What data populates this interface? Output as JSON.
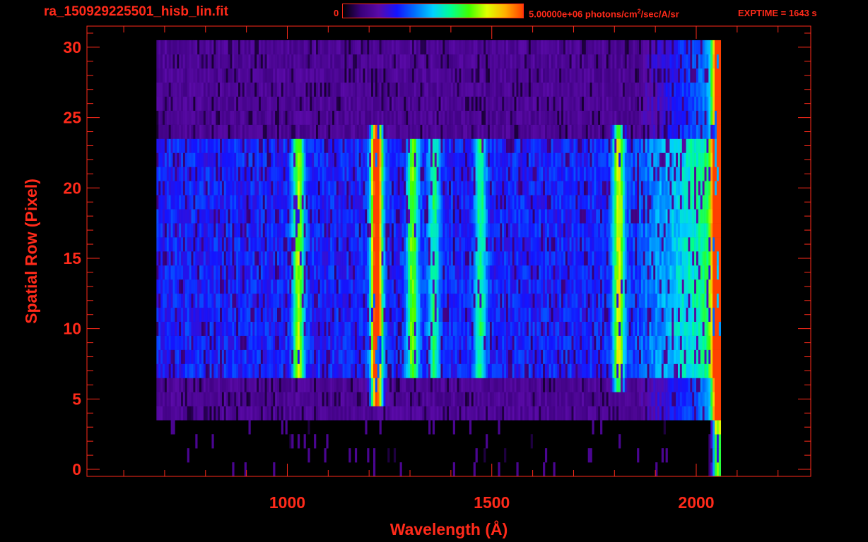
{
  "header": {
    "file_title": "ra_150929225501_hisb_lin.fit",
    "colorbar_min": "0",
    "colorbar_max_prefix": "5.00000e+06 photons/cm",
    "colorbar_max_sup": "2",
    "colorbar_max_suffix": "/sec/A/sr",
    "exptime": "EXPTIME = 1643 s"
  },
  "colors": {
    "text_and_axes": "#ff2a1a",
    "background": "#000000",
    "colormap": [
      "#000000",
      "#3a007a",
      "#5a0aa8",
      "#1414ff",
      "#0070ff",
      "#00d0ff",
      "#00ff90",
      "#40ff00",
      "#e0ff00",
      "#ffb000",
      "#ff4000"
    ]
  },
  "chart_data": {
    "type": "heatmap",
    "xlabel": "Wavelength (Å)",
    "ylabel": "Spatial Row (Pixel)",
    "xlim": [
      510,
      2280
    ],
    "ylim": [
      -0.5,
      31.5
    ],
    "x_ticks": [
      1000,
      1500,
      2000
    ],
    "y_ticks": [
      0,
      5,
      10,
      15,
      20,
      25,
      30
    ],
    "colorbar_range": [
      0,
      5000000
    ],
    "colorbar_unit": "photons/cm^2/sec/A/sr",
    "data_extent_wavelength": [
      680,
      2060
    ],
    "illuminated_rows": [
      7,
      23
    ],
    "noise_rows": [
      4,
      30
    ],
    "emission_features": [
      {
        "wavelength": 1025,
        "rows": [
          7,
          23
        ],
        "level": 0.45
      },
      {
        "wavelength": 1216,
        "rows": [
          5,
          24
        ],
        "level": 0.85
      },
      {
        "wavelength": 1304,
        "rows": [
          7,
          23
        ],
        "level": 0.42
      },
      {
        "wavelength": 1356,
        "rows": [
          7,
          23
        ],
        "level": 0.3
      },
      {
        "wavelength": 1470,
        "rows": [
          7,
          23
        ],
        "level": 0.3
      },
      {
        "wavelength": 1808,
        "rows": [
          6,
          24
        ],
        "level": 0.5
      },
      {
        "wavelength": 2050,
        "rows": [
          0,
          30
        ],
        "level": 0.75
      }
    ]
  }
}
